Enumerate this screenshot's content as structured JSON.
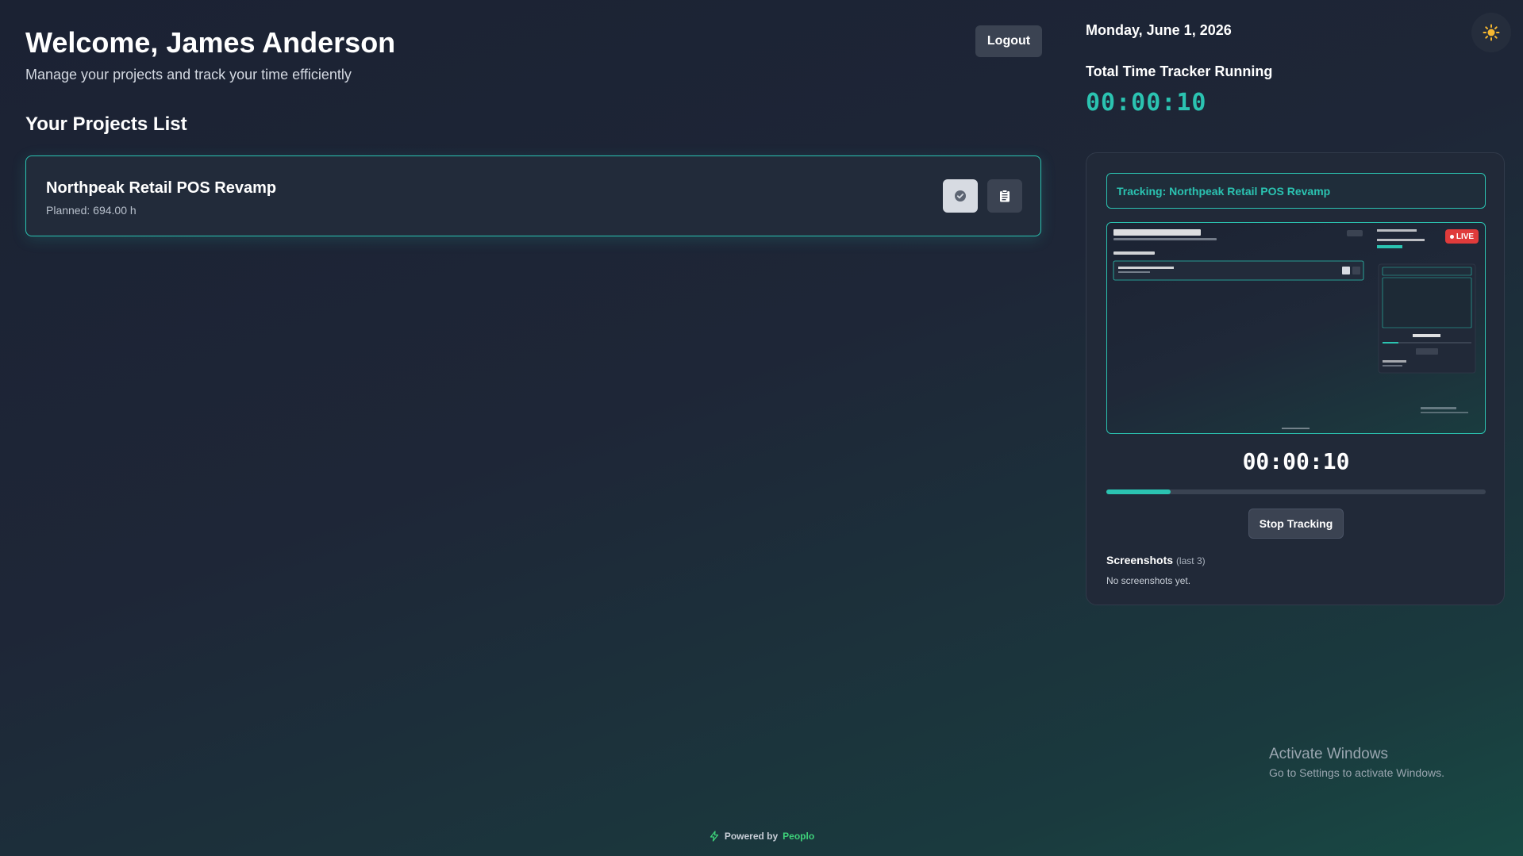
{
  "header": {
    "welcome": "Welcome, James Anderson",
    "subtitle": "Manage your projects and track your time efficiently",
    "logout_label": "Logout"
  },
  "projects": {
    "heading": "Your Projects List",
    "items": [
      {
        "name": "Northpeak Retail POS Revamp",
        "planned": "Planned: 694.00 h"
      }
    ]
  },
  "sidebar": {
    "date": "Monday, June 1, 2026",
    "tracker_title": "Total Time Tracker Running",
    "tracker_time": "00:00:10",
    "theme_icon": "sun-icon"
  },
  "panel": {
    "tracking_label": "Tracking: Northpeak Retail POS Revamp",
    "live_label": "LIVE",
    "timer": "00:00:10",
    "progress": 0.17,
    "stop_label": "Stop Tracking",
    "screenshots_label": "Screenshots",
    "screenshots_sub": "(last 3)",
    "screenshots_empty": "No screenshots yet."
  },
  "watermark": {
    "line1": "Activate Windows",
    "line2": "Go to Settings to activate Windows."
  },
  "footer": {
    "powered_by": "Powered by",
    "brand": "Peoplo"
  },
  "colors": {
    "accent": "#2bc3b1",
    "live": "#e03b3b",
    "brand": "#3ed27a"
  }
}
